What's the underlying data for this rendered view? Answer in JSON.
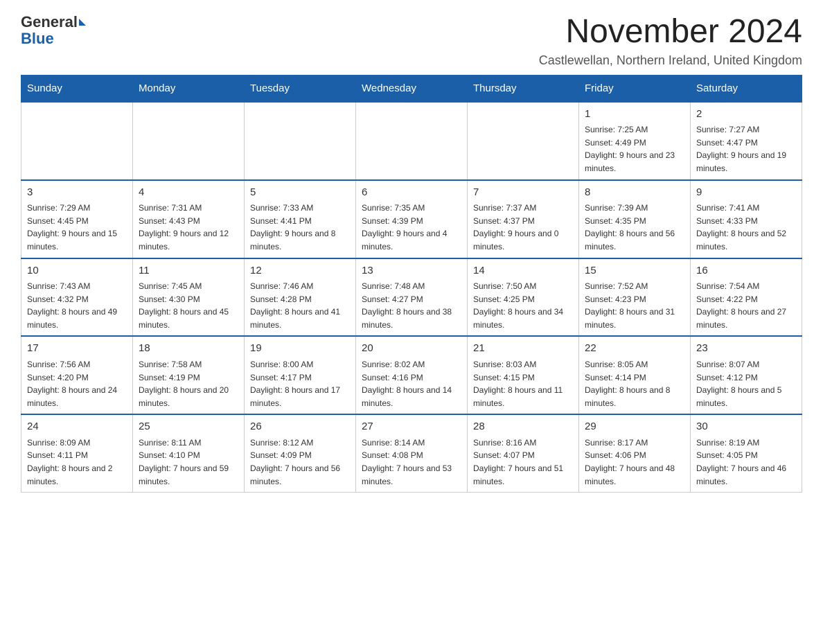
{
  "logo": {
    "general": "General",
    "blue": "Blue"
  },
  "header": {
    "month_year": "November 2024",
    "location": "Castlewellan, Northern Ireland, United Kingdom"
  },
  "weekdays": [
    "Sunday",
    "Monday",
    "Tuesday",
    "Wednesday",
    "Thursday",
    "Friday",
    "Saturday"
  ],
  "weeks": [
    [
      {
        "day": "",
        "info": ""
      },
      {
        "day": "",
        "info": ""
      },
      {
        "day": "",
        "info": ""
      },
      {
        "day": "",
        "info": ""
      },
      {
        "day": "",
        "info": ""
      },
      {
        "day": "1",
        "info": "Sunrise: 7:25 AM\nSunset: 4:49 PM\nDaylight: 9 hours and 23 minutes."
      },
      {
        "day": "2",
        "info": "Sunrise: 7:27 AM\nSunset: 4:47 PM\nDaylight: 9 hours and 19 minutes."
      }
    ],
    [
      {
        "day": "3",
        "info": "Sunrise: 7:29 AM\nSunset: 4:45 PM\nDaylight: 9 hours and 15 minutes."
      },
      {
        "day": "4",
        "info": "Sunrise: 7:31 AM\nSunset: 4:43 PM\nDaylight: 9 hours and 12 minutes."
      },
      {
        "day": "5",
        "info": "Sunrise: 7:33 AM\nSunset: 4:41 PM\nDaylight: 9 hours and 8 minutes."
      },
      {
        "day": "6",
        "info": "Sunrise: 7:35 AM\nSunset: 4:39 PM\nDaylight: 9 hours and 4 minutes."
      },
      {
        "day": "7",
        "info": "Sunrise: 7:37 AM\nSunset: 4:37 PM\nDaylight: 9 hours and 0 minutes."
      },
      {
        "day": "8",
        "info": "Sunrise: 7:39 AM\nSunset: 4:35 PM\nDaylight: 8 hours and 56 minutes."
      },
      {
        "day": "9",
        "info": "Sunrise: 7:41 AM\nSunset: 4:33 PM\nDaylight: 8 hours and 52 minutes."
      }
    ],
    [
      {
        "day": "10",
        "info": "Sunrise: 7:43 AM\nSunset: 4:32 PM\nDaylight: 8 hours and 49 minutes."
      },
      {
        "day": "11",
        "info": "Sunrise: 7:45 AM\nSunset: 4:30 PM\nDaylight: 8 hours and 45 minutes."
      },
      {
        "day": "12",
        "info": "Sunrise: 7:46 AM\nSunset: 4:28 PM\nDaylight: 8 hours and 41 minutes."
      },
      {
        "day": "13",
        "info": "Sunrise: 7:48 AM\nSunset: 4:27 PM\nDaylight: 8 hours and 38 minutes."
      },
      {
        "day": "14",
        "info": "Sunrise: 7:50 AM\nSunset: 4:25 PM\nDaylight: 8 hours and 34 minutes."
      },
      {
        "day": "15",
        "info": "Sunrise: 7:52 AM\nSunset: 4:23 PM\nDaylight: 8 hours and 31 minutes."
      },
      {
        "day": "16",
        "info": "Sunrise: 7:54 AM\nSunset: 4:22 PM\nDaylight: 8 hours and 27 minutes."
      }
    ],
    [
      {
        "day": "17",
        "info": "Sunrise: 7:56 AM\nSunset: 4:20 PM\nDaylight: 8 hours and 24 minutes."
      },
      {
        "day": "18",
        "info": "Sunrise: 7:58 AM\nSunset: 4:19 PM\nDaylight: 8 hours and 20 minutes."
      },
      {
        "day": "19",
        "info": "Sunrise: 8:00 AM\nSunset: 4:17 PM\nDaylight: 8 hours and 17 minutes."
      },
      {
        "day": "20",
        "info": "Sunrise: 8:02 AM\nSunset: 4:16 PM\nDaylight: 8 hours and 14 minutes."
      },
      {
        "day": "21",
        "info": "Sunrise: 8:03 AM\nSunset: 4:15 PM\nDaylight: 8 hours and 11 minutes."
      },
      {
        "day": "22",
        "info": "Sunrise: 8:05 AM\nSunset: 4:14 PM\nDaylight: 8 hours and 8 minutes."
      },
      {
        "day": "23",
        "info": "Sunrise: 8:07 AM\nSunset: 4:12 PM\nDaylight: 8 hours and 5 minutes."
      }
    ],
    [
      {
        "day": "24",
        "info": "Sunrise: 8:09 AM\nSunset: 4:11 PM\nDaylight: 8 hours and 2 minutes."
      },
      {
        "day": "25",
        "info": "Sunrise: 8:11 AM\nSunset: 4:10 PM\nDaylight: 7 hours and 59 minutes."
      },
      {
        "day": "26",
        "info": "Sunrise: 8:12 AM\nSunset: 4:09 PM\nDaylight: 7 hours and 56 minutes."
      },
      {
        "day": "27",
        "info": "Sunrise: 8:14 AM\nSunset: 4:08 PM\nDaylight: 7 hours and 53 minutes."
      },
      {
        "day": "28",
        "info": "Sunrise: 8:16 AM\nSunset: 4:07 PM\nDaylight: 7 hours and 51 minutes."
      },
      {
        "day": "29",
        "info": "Sunrise: 8:17 AM\nSunset: 4:06 PM\nDaylight: 7 hours and 48 minutes."
      },
      {
        "day": "30",
        "info": "Sunrise: 8:19 AM\nSunset: 4:05 PM\nDaylight: 7 hours and 46 minutes."
      }
    ]
  ]
}
